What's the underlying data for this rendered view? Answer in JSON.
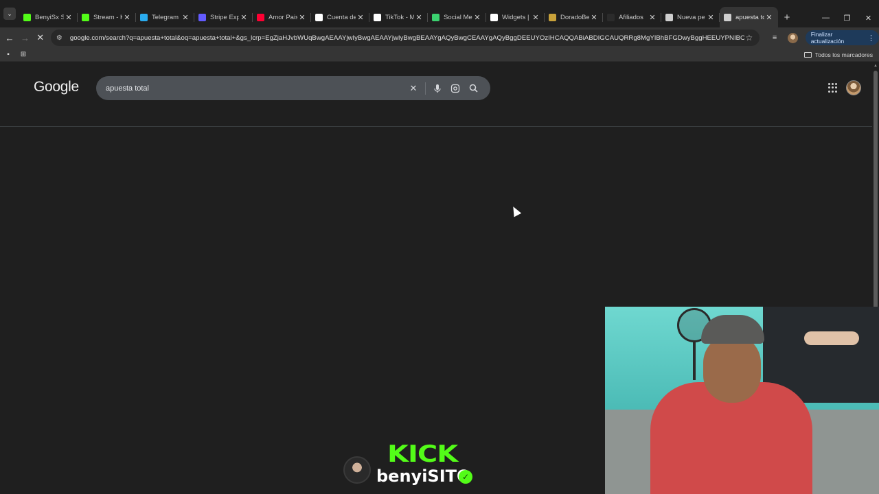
{
  "browser": {
    "tabs": [
      {
        "title": "BenyiSx St",
        "favicon": "kick-icon",
        "color": "#53fc18",
        "active": false
      },
      {
        "title": "Stream - K",
        "favicon": "kick-icon",
        "color": "#53fc18",
        "active": false
      },
      {
        "title": "Telegram",
        "favicon": "telegram-icon",
        "color": "#2aabee",
        "active": false
      },
      {
        "title": "Stripe Exp",
        "favicon": "stripe-icon",
        "color": "#635bff",
        "active": false
      },
      {
        "title": "Amor Pais",
        "favicon": "youtube-icon",
        "color": "#ff0033",
        "active": false
      },
      {
        "title": "Cuenta de",
        "favicon": "google-icon",
        "color": "#ffffff",
        "active": false
      },
      {
        "title": "TikTok - M",
        "favicon": "tiktok-icon",
        "color": "#ffffff",
        "active": false
      },
      {
        "title": "Social Me",
        "favicon": "social-icon",
        "color": "#3bd16f",
        "active": false
      },
      {
        "title": "Widgets |",
        "favicon": "widgets-icon",
        "color": "#ffffff",
        "active": false
      },
      {
        "title": "DoradoBe",
        "favicon": "dorado-icon",
        "color": "#c9a23a",
        "active": false
      },
      {
        "title": "Afiliados",
        "favicon": "afiliados-icon",
        "color": "#2b2b2b",
        "active": false
      },
      {
        "title": "Nueva pe",
        "favicon": "chrome-icon",
        "color": "#cfcfcf",
        "active": false
      },
      {
        "title": "apuesta to",
        "favicon": "loading-icon",
        "color": "#cfcfcf",
        "active": true
      }
    ],
    "new_tab_glyph": "+",
    "close_glyph": "✕",
    "url": "google.com/search?q=apuesta+total&oq=apuesta+total+&gs_lcrp=EgZjaHJvbWUqBwgAEAAYjwIyBwgAEAAYjwIyBwgBEAAYgAQyBwgCEAAYgAQyBggDEEUYOzIHCAQQABiABDIGCAUQRRg8MgYIBhBFGDwyBggHEEUYPNIBCDUwMDhqMG...",
    "update_button": "Finalizar actualización",
    "bookmarks_all": "Todos los marcadores"
  },
  "page": {
    "logo_text": "Google",
    "search_query": "apuesta total"
  },
  "overlay": {
    "kick_logo": "KICK",
    "kick_username": "benyiSITO"
  }
}
